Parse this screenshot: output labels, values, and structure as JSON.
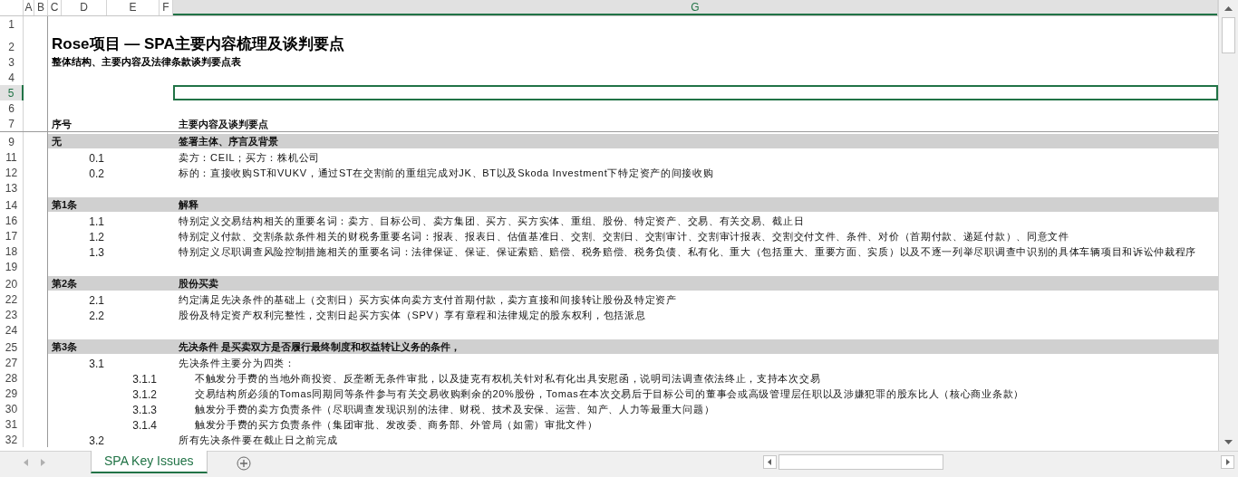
{
  "columns": [
    {
      "label": "A",
      "selected": false
    },
    {
      "label": "B",
      "selected": false
    },
    {
      "label": "C",
      "selected": false
    },
    {
      "label": "D",
      "selected": false
    },
    {
      "label": "E",
      "selected": false
    },
    {
      "label": "F",
      "selected": false
    },
    {
      "label": "G",
      "selected": true
    }
  ],
  "rows": [
    {
      "number": "1",
      "kind": "blank",
      "selected": false
    },
    {
      "number": "2",
      "kind": "title",
      "selected": false,
      "text": "Rose项目 — SPA主要内容梳理及谈判要点"
    },
    {
      "number": "3",
      "kind": "subtitle",
      "selected": false,
      "text": "整体结构、主要内容及法律条款谈判要点表"
    },
    {
      "number": "4",
      "kind": "blank",
      "selected": false
    },
    {
      "number": "5",
      "kind": "blank",
      "selected": true
    },
    {
      "number": "6",
      "kind": "blank",
      "selected": false
    },
    {
      "number": "7",
      "kind": "header",
      "selected": false,
      "label": "序号",
      "text": "主要内容及谈判要点"
    },
    {
      "number": "9",
      "kind": "section",
      "selected": false,
      "label": "无",
      "text": "签署主体、序言及背景"
    },
    {
      "number": "11",
      "kind": "item",
      "selected": false,
      "label": "0.1",
      "text": "卖方：CEIL；买方：株机公司"
    },
    {
      "number": "12",
      "kind": "item",
      "selected": false,
      "label": "0.2",
      "text": "标的：直接收购ST和VUKV，通过ST在交割前的重组完成对JK、BT以及Skoda Investment下特定资产的间接收购"
    },
    {
      "number": "13",
      "kind": "blank",
      "selected": false
    },
    {
      "number": "14",
      "kind": "section",
      "selected": false,
      "label": "第1条",
      "text": "解释"
    },
    {
      "number": "16",
      "kind": "item",
      "selected": false,
      "label": "1.1",
      "text": "特别定义交易结构相关的重要名词：卖方、目标公司、卖方集团、买方、买方实体、重组、股份、特定资产、交易、有关交易、截止日"
    },
    {
      "number": "17",
      "kind": "item",
      "selected": false,
      "label": "1.2",
      "text": "特别定义付款、交割条款条件相关的财税务重要名词：报表、报表日、估值基准日、交割、交割日、交割审计、交割审计报表、交割交付文件、条件、对价（首期付款、递延付款）、同意文件"
    },
    {
      "number": "18",
      "kind": "item",
      "selected": false,
      "label": "1.3",
      "text": "特别定义尽职调查风险控制措施相关的重要名词：法律保证、保证、保证索赔、赔偿、税务赔偿、税务负债、私有化、重大（包括重大、重要方面、实质）以及不逐一列举尽职调查中识别的具体车辆项目和诉讼仲裁程序"
    },
    {
      "number": "19",
      "kind": "blank",
      "selected": false
    },
    {
      "number": "20",
      "kind": "section",
      "selected": false,
      "label": "第2条",
      "text": "股份买卖"
    },
    {
      "number": "22",
      "kind": "item",
      "selected": false,
      "label": "2.1",
      "text": "约定满足先决条件的基础上（交割日）买方实体向卖方支付首期付款，卖方直接和间接转让股份及特定资产"
    },
    {
      "number": "23",
      "kind": "item",
      "selected": false,
      "label": "2.2",
      "text": "股份及特定资产权利完整性，交割日起买方实体（SPV）享有章程和法律规定的股东权利，包括派息"
    },
    {
      "number": "24",
      "kind": "blank",
      "selected": false
    },
    {
      "number": "25",
      "kind": "section",
      "selected": false,
      "label": "第3条",
      "text": "先决条件 是买卖双方是否履行最终制度和权益转让义务的条件，"
    },
    {
      "number": "27",
      "kind": "item",
      "selected": false,
      "label": "3.1",
      "text": "先决条件主要分为四类："
    },
    {
      "number": "28",
      "kind": "subitem",
      "selected": false,
      "label": "3.1.1",
      "text": "不触发分手费的当地外商投资、反垄断无条件审批，以及捷克有权机关针对私有化出具安慰函，说明司法调查依法终止，支持本次交易"
    },
    {
      "number": "29",
      "kind": "subitem",
      "selected": false,
      "label": "3.1.2",
      "text": "交易结构所必须的Tomas同期同等条件参与有关交易收购剩余的20%股份，Tomas在本次交易后于目标公司的董事会或高级管理层任职以及涉嫌犯罪的股东比人（核心商业条款）"
    },
    {
      "number": "30",
      "kind": "subitem",
      "selected": false,
      "label": "3.1.3",
      "text": "触发分手费的卖方负责条件（尽职调查发现识别的法律、财税、技术及安保、运营、知产、人力等最重大问题）"
    },
    {
      "number": "31",
      "kind": "subitem",
      "selected": false,
      "label": "3.1.4",
      "text": "触发分手费的买方负责条件（集团审批、发改委、商务部、外管局（如需）审批文件）"
    },
    {
      "number": "32",
      "kind": "item",
      "selected": false,
      "label": "3.2",
      "text": "所有先决条件要在截止日之前完成"
    }
  ],
  "sheet_tabs": [
    {
      "label": "SPA Key Issues",
      "selected": true
    }
  ]
}
